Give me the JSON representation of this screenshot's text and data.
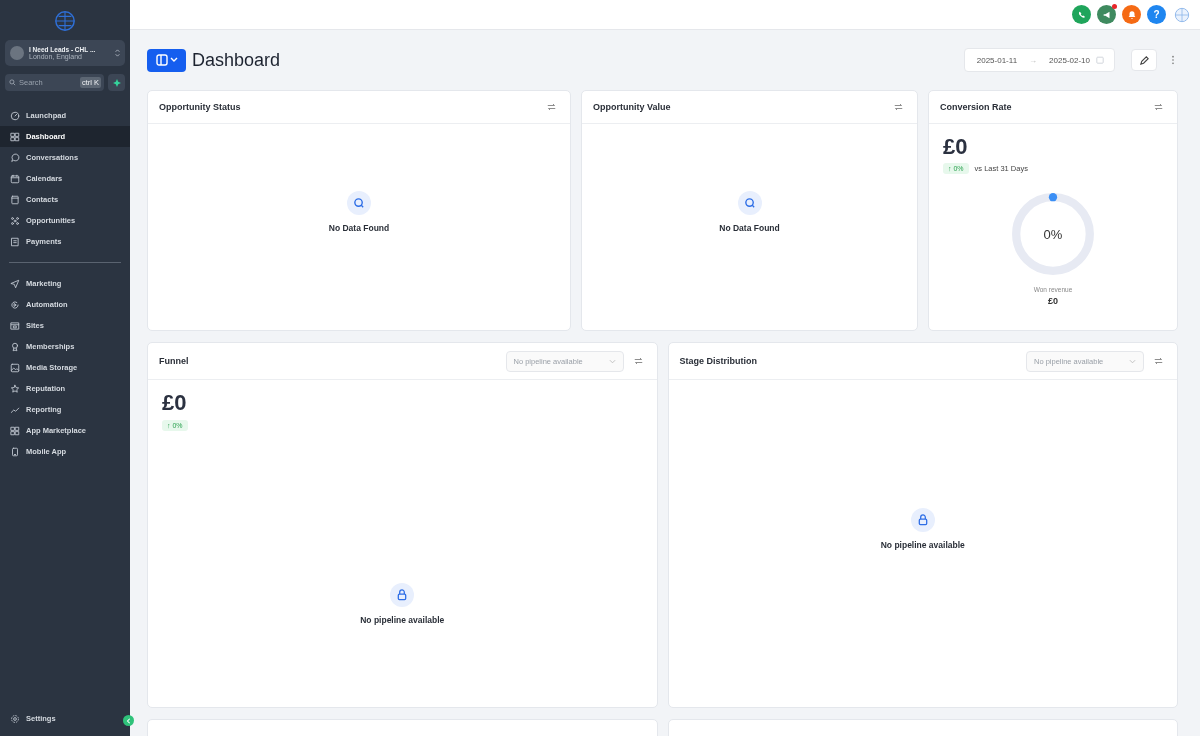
{
  "sidebar": {
    "account": {
      "name": "I Need Leads - CHL ...",
      "location": "London, England"
    },
    "search": {
      "placeholder": "Search",
      "shortcut": "ctrl K"
    },
    "primary_items": [
      {
        "label": "Launchpad",
        "selected": false
      },
      {
        "label": "Dashboard",
        "selected": true
      },
      {
        "label": "Conversations",
        "selected": false
      },
      {
        "label": "Calendars",
        "selected": false
      },
      {
        "label": "Contacts",
        "selected": false
      },
      {
        "label": "Opportunities",
        "selected": false
      },
      {
        "label": "Payments",
        "selected": false
      }
    ],
    "secondary_items": [
      {
        "label": "Marketing",
        "selected": false
      },
      {
        "label": "Automation",
        "selected": false
      },
      {
        "label": "Sites",
        "selected": false
      },
      {
        "label": "Memberships",
        "selected": false
      },
      {
        "label": "Media Storage",
        "selected": false
      },
      {
        "label": "Reputation",
        "selected": false
      },
      {
        "label": "Reporting",
        "selected": false
      },
      {
        "label": "App Marketplace",
        "selected": false
      },
      {
        "label": "Mobile App",
        "selected": false
      }
    ],
    "settings": "Settings"
  },
  "header": {
    "help_glyph": "?",
    "notification_dot": true
  },
  "page": {
    "title": "Dashboard",
    "date_from": "2025-01-11",
    "date_separator": "→",
    "date_to": "2025-02-10"
  },
  "widgets": [
    {
      "kind": "empty",
      "title": "Opportunity Status",
      "message": "No Data Found"
    },
    {
      "kind": "empty",
      "title": "Opportunity Value",
      "message": "No Data Found"
    },
    {
      "kind": "conversion",
      "title": "Conversion Rate",
      "value": "£0",
      "change": "↑ 0%",
      "comparison": "vs Last 31 Days",
      "gauge_label": "0%",
      "caption": "Won revenue",
      "caption_value": "£0"
    },
    {
      "kind": "funnel",
      "title": "Funnel",
      "select_placeholder": "No pipeline available",
      "value": "£0",
      "change": "↑ 0%",
      "message": "No pipeline available"
    },
    {
      "kind": "stage",
      "title": "Stage Distribution",
      "select_placeholder": "No pipeline available",
      "message": "No pipeline available"
    }
  ]
}
